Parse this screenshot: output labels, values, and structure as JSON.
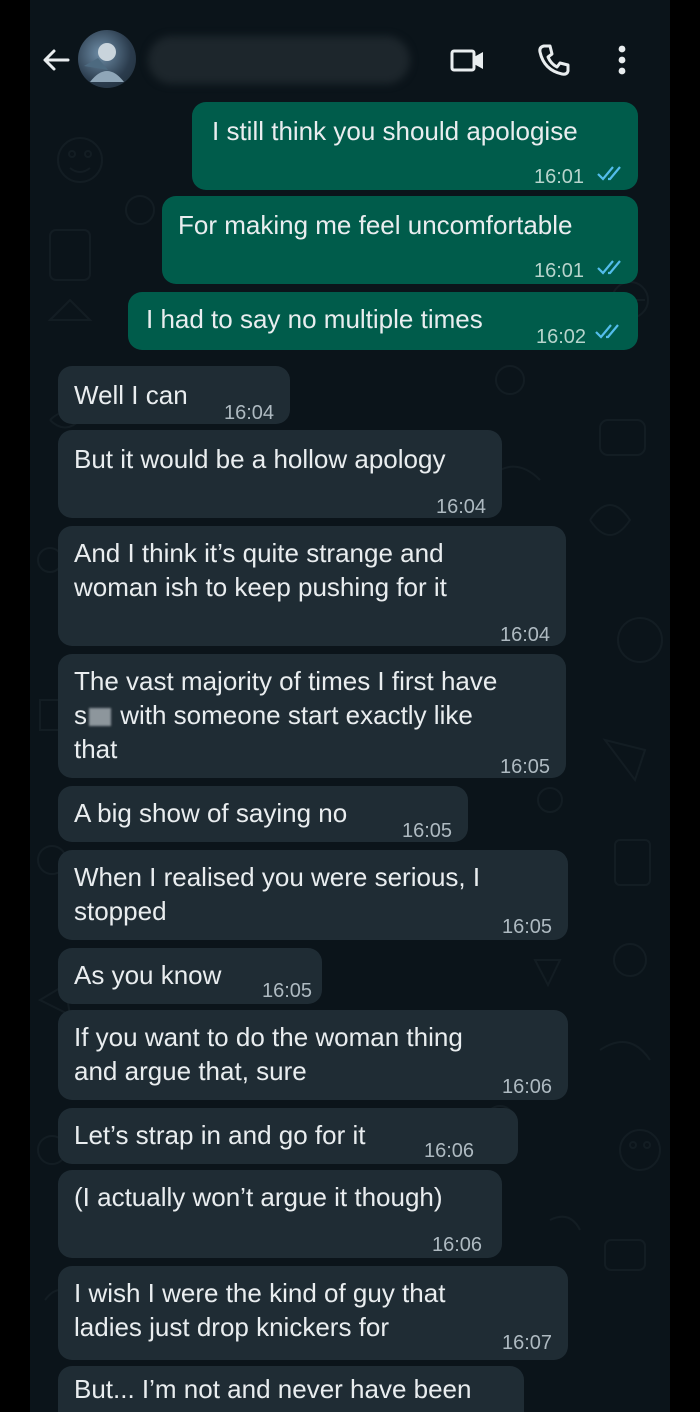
{
  "header": {
    "contact_name": "",
    "icons": [
      "back-arrow-icon",
      "contact-avatar",
      "video-call-icon",
      "voice-call-icon",
      "more-options-icon"
    ]
  },
  "colors": {
    "background": "#0b141a",
    "outgoing_bubble": "#005c4b",
    "incoming_bubble": "#1f2c34",
    "text": "#e9edef",
    "read_ticks": "#53bdeb"
  },
  "messages": [
    {
      "direction": "out",
      "text": "I still think you should apologise",
      "time": "16:01",
      "status": "read"
    },
    {
      "direction": "out",
      "text": "For making me feel uncomfortable",
      "time": "16:01",
      "status": "read"
    },
    {
      "direction": "out",
      "text": "I had to say no multiple times",
      "time": "16:02",
      "status": "read"
    },
    {
      "direction": "in",
      "text": "Well I can",
      "time": "16:04"
    },
    {
      "direction": "in",
      "text": "But it would be a hollow apology",
      "time": "16:04"
    },
    {
      "direction": "in",
      "text": "And I think it’s quite strange and\nwoman ish to keep pushing for it",
      "time": "16:04"
    },
    {
      "direction": "in",
      "text": "The vast majority of times I first have",
      "text_line2_start": "s",
      "text_line2_rest": " with someone start exactly like",
      "text_line3": "that",
      "time": "16:05"
    },
    {
      "direction": "in",
      "text": "A big show of saying no",
      "time": "16:05"
    },
    {
      "direction": "in",
      "text": "When I realised you were serious, I\nstopped",
      "time": "16:05"
    },
    {
      "direction": "in",
      "text": "As you know",
      "time": "16:05"
    },
    {
      "direction": "in",
      "text": "If you want to do the woman thing\nand argue that, sure",
      "time": "16:06"
    },
    {
      "direction": "in",
      "text": "Let’s strap in and go for it",
      "time": "16:06"
    },
    {
      "direction": "in",
      "text": "(I actually won’t argue it though)",
      "time": "16:06"
    },
    {
      "direction": "in",
      "text": "I wish I were the kind of guy that\nladies just drop knickers for",
      "time": "16:07"
    },
    {
      "direction": "in",
      "text": "But... I’m not and never have been",
      "time": ""
    }
  ]
}
